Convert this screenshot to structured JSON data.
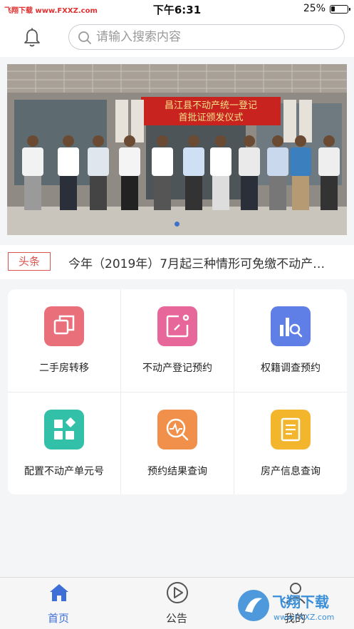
{
  "status_bar": {
    "carrier": "飞翔下载 www.FXXZ.com",
    "time": "下午6:31",
    "battery": "25%",
    "battery_level": 0.25
  },
  "header": {
    "search_placeholder": "请输入搜索内容"
  },
  "banner": {
    "sign_text": "昌江县不动产统一登记首批证颁发仪式",
    "sign_line1": "昌江县不动产统一登记",
    "sign_line2": "首批证颁发仪式",
    "slide_count": 1,
    "active_slide": 0
  },
  "news": {
    "badge": "头条",
    "headline": "今年（2019年）7月起三种情形可免缴不动产…"
  },
  "services": [
    {
      "label": "二手房转移",
      "color": "#e9707b",
      "icon": "copy-icon"
    },
    {
      "label": "不动产登记预约",
      "color": "#e8679a",
      "icon": "edit-icon"
    },
    {
      "label": "权籍调查预约",
      "color": "#5f7ee6",
      "icon": "chart-search-icon"
    },
    {
      "label": "配置不动产单元号",
      "color": "#33c0a8",
      "icon": "grid-icon"
    },
    {
      "label": "预约结果查询",
      "color": "#f0904a",
      "icon": "pulse-search-icon"
    },
    {
      "label": "房产信息查询",
      "color": "#f3b52c",
      "icon": "document-icon"
    }
  ],
  "tabbar": {
    "tabs": [
      {
        "label": "首页",
        "active": true,
        "icon": "home-icon"
      },
      {
        "label": "公告",
        "active": false,
        "icon": "play-circle-icon"
      },
      {
        "label": "我的",
        "active": false,
        "icon": "user-icon"
      }
    ],
    "active_color": "#3d6fd6"
  },
  "watermark": {
    "brand": "飞翔下载",
    "url": "www.FXXZ.com"
  }
}
